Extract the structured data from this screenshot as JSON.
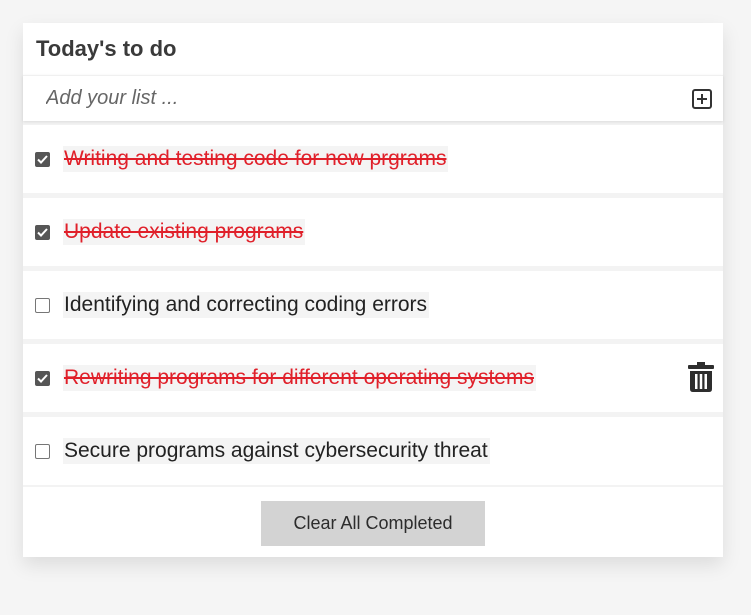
{
  "header": {
    "title": "Today's to do"
  },
  "add": {
    "placeholder": "Add your list ...",
    "icon": "plus-square-icon"
  },
  "todos": [
    {
      "label": "Writing and testing code for new prgrams",
      "done": true
    },
    {
      "label": "Update existing programs",
      "done": true
    },
    {
      "label": "Identifying and correcting coding errors",
      "done": false
    },
    {
      "label": "Rewriting programs for different operating systems",
      "done": true
    },
    {
      "label": "Secure programs against cybersecurity threat",
      "done": false
    }
  ],
  "footer": {
    "clear_label": "Clear All Completed"
  },
  "colors": {
    "done_text": "#e0202a",
    "checkbox": "#565656",
    "button": "#d3d3d3"
  }
}
